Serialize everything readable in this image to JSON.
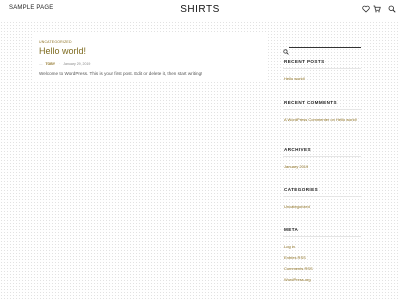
{
  "header": {
    "nav_link": "Sample Page",
    "site_title": "SHIRTS",
    "icons": [
      "heart-icon",
      "cart-icon",
      "search-icon"
    ]
  },
  "post": {
    "category": "Uncategorized",
    "title": "Hello world!",
    "author": "TOBY",
    "date": "January 29, 2019",
    "excerpt": "Welcome to WordPress. This is your first post. Edit or delete it, then start writing!"
  },
  "sidebar": {
    "recent_posts": {
      "title": "Recent Posts",
      "items": [
        "Hello world!"
      ]
    },
    "recent_comments": {
      "title": "Recent Comments",
      "items": [
        "A WordPress Commenter on Hello world!"
      ]
    },
    "archives": {
      "title": "Archives",
      "items": [
        "January 2019"
      ]
    },
    "categories": {
      "title": "Categories",
      "items": [
        "Uncategorized"
      ]
    },
    "meta": {
      "title": "Meta",
      "items": [
        "Log in",
        "Entries RSS",
        "Comments RSS",
        "WordPress.org"
      ]
    }
  },
  "colors": {
    "accent": "#8a6d1d",
    "title": "#7d6a1e",
    "text": "#555555"
  }
}
